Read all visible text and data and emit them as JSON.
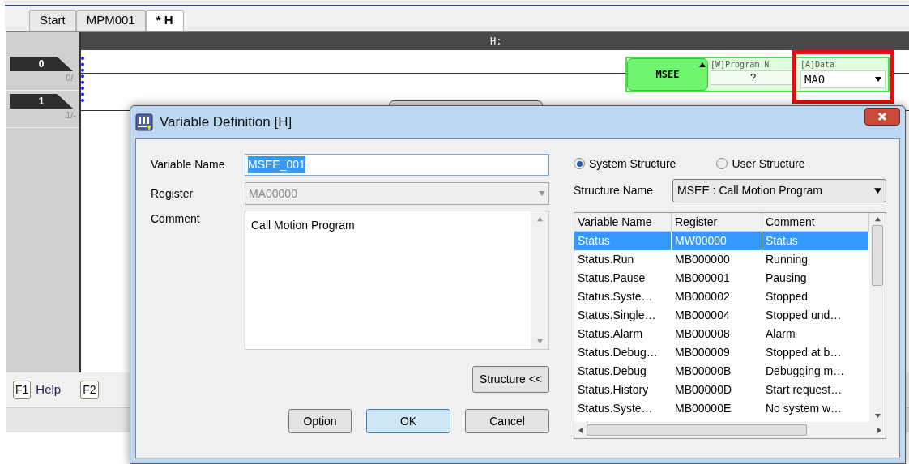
{
  "tabs": [
    {
      "label": "Start",
      "selected": false
    },
    {
      "label": "MPM001",
      "selected": false
    },
    {
      "label": "* H",
      "selected": true
    }
  ],
  "ladder": {
    "header": "H:",
    "rungs": [
      {
        "number": "0",
        "step": "0/-"
      },
      {
        "number": "1",
        "step": "1/-"
      }
    ],
    "block": {
      "name": "MSEE",
      "params": [
        {
          "label": "[W]Program N",
          "value": "?",
          "kind": "text",
          "highlighted": false
        },
        {
          "label": "[A]Data",
          "value": "MA0",
          "kind": "dropdown",
          "highlighted": true
        }
      ]
    }
  },
  "function_keys": [
    {
      "key": "F1",
      "label": "Help"
    },
    {
      "key": "F2"
    }
  ],
  "dialog": {
    "title": "Variable Definition [H]",
    "variable_name": {
      "label": "Variable Name",
      "value": "MSEE_001",
      "selected": true
    },
    "register": {
      "label": "Register",
      "value": "MA00000",
      "disabled": true
    },
    "comment": {
      "label": "Comment",
      "value": "Call Motion Program"
    },
    "structure_button": "Structure <<",
    "buttons": [
      {
        "label": "Option",
        "default": false
      },
      {
        "label": "OK",
        "default": true
      },
      {
        "label": "Cancel",
        "default": false
      }
    ],
    "structure_types": [
      {
        "label": "System Structure",
        "selected": true
      },
      {
        "label": "User Structure",
        "selected": false
      }
    ],
    "structure_name": {
      "label": "Structure Name",
      "value": "MSEE : Call Motion Program"
    },
    "table": {
      "columns": [
        "Variable Name",
        "Register",
        "Comment"
      ],
      "rows": [
        {
          "cells": [
            "Status",
            "MW00000",
            "Status"
          ],
          "selected": true
        },
        {
          "cells": [
            "Status.Run",
            "MB000000",
            "Running"
          ],
          "selected": false
        },
        {
          "cells": [
            "Status.Pause",
            "MB000001",
            "Pausing"
          ],
          "selected": false
        },
        {
          "cells": [
            "Status.Syste…",
            "MB000002",
            "Stopped"
          ],
          "selected": false
        },
        {
          "cells": [
            "Status.Single…",
            "MB000004",
            "Stopped und…"
          ],
          "selected": false
        },
        {
          "cells": [
            "Status.Alarm",
            "MB000008",
            "Alarm"
          ],
          "selected": false
        },
        {
          "cells": [
            "Status.Debug…",
            "MB000009",
            "Stopped at b…"
          ],
          "selected": false
        },
        {
          "cells": [
            "Status.Debug",
            "MB00000B",
            "Debugging m…"
          ],
          "selected": false
        },
        {
          "cells": [
            "Status.History",
            "MB00000D",
            "Start request…"
          ],
          "selected": false
        },
        {
          "cells": [
            "Status.Syste…",
            "MB00000E",
            "No system w…"
          ],
          "selected": false
        }
      ]
    }
  }
}
